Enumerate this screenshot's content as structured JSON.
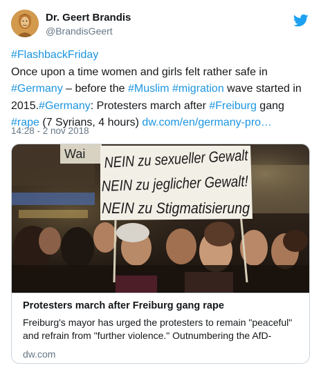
{
  "tweet": {
    "display_name": "Dr. Geert Brandis",
    "handle": "@BrandisGeert",
    "avatar_icon": "portrait-avatar",
    "brand_icon": "twitter-bird-icon",
    "brand_color": "#1da1f2",
    "link_color": "#1b95e0",
    "text": {
      "hashtag_flashback": "#FlashbackFriday",
      "line_1": "Once upon a time women and girls felt rather safe in",
      "hashtag_germany": "#Germany",
      "part_2": " – before the ",
      "hashtag_muslim": "#Muslim",
      "space_1": " ",
      "hashtag_migration": "#migration",
      "part_3": " wave started in 2015.",
      "hashtag_germany_2": "#Germany",
      "part_4": ": Protesters march after ",
      "hashtag_freiburg": "#Freiburg",
      "part_5": " gang ",
      "hashtag_rape": "#rape",
      "part_6": " (7 Syrians, 4 hours) ",
      "url": "dw.com/en/germany-pro…"
    },
    "timestamp": "14:28 - 2 nov 2018"
  },
  "card": {
    "title": "Protesters march after Freiburg gang rape",
    "description": "Freiburg's mayor has urged the protesters to remain \"peaceful\" and refrain from \"further violence.\" Outnumbering the AfD-",
    "domain": "dw.com",
    "image": {
      "sign_line_1": "NEIN zu sexueller Gewalt",
      "sign_line_2": "NEIN zu jeglicher Gewalt!",
      "sign_line_3": "NEIN zu Stigmatisierung",
      "banner_fragment": "Wai"
    }
  }
}
